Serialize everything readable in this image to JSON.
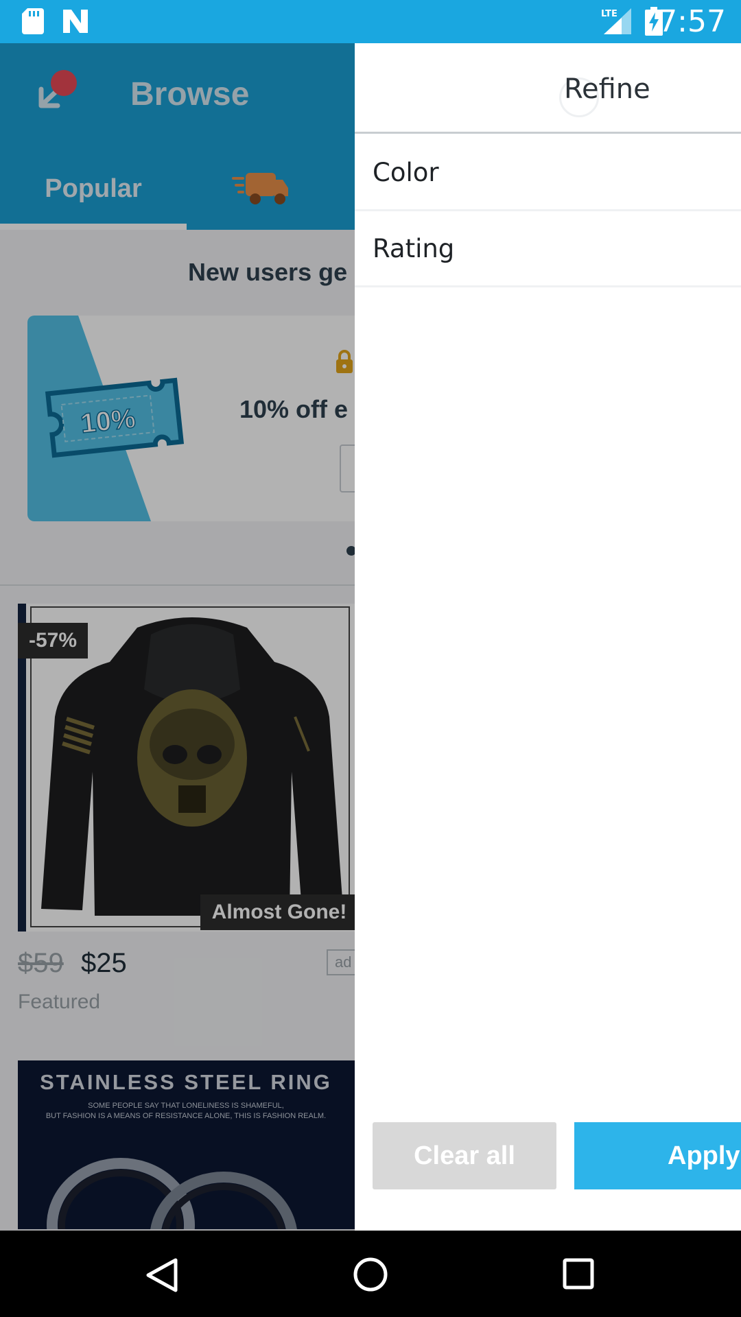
{
  "status_bar": {
    "time": "7:57",
    "network": "LTE",
    "icons": [
      "sd-card-icon",
      "n-notification-icon",
      "lte-signal-icon",
      "battery-charging-icon"
    ]
  },
  "header": {
    "title": "Browse",
    "tabs": [
      {
        "label": "Popular",
        "selected": true
      },
      {
        "label": "",
        "icon": "delivery-truck-icon"
      }
    ]
  },
  "promo": {
    "headline": "New users ge",
    "coupon_text": "10%",
    "offer": "10% off e"
  },
  "product": {
    "discount": "-57%",
    "badge": "Almost Gone!",
    "old_price": "$59",
    "new_price": "$25",
    "ad_tag": "ad",
    "label": "Featured"
  },
  "ring_banner": {
    "title": "STAINLESS STEEL RING",
    "subtitle_line1": "SOME PEOPLE SAY THAT LONELINESS IS SHAMEFUL,",
    "subtitle_line2": "BUT FASHION IS A MEANS OF RESISTANCE ALONE, THIS IS FASHION REALM."
  },
  "drawer": {
    "title": "Refine",
    "filters": [
      "Color",
      "Rating"
    ],
    "clear_label": "Clear all",
    "apply_label": "Apply"
  },
  "colors": {
    "status_bar": "#1aa7e0",
    "header": "#1b9fd4",
    "apply": "#2db4ea",
    "clear": "#d8d8d8"
  }
}
